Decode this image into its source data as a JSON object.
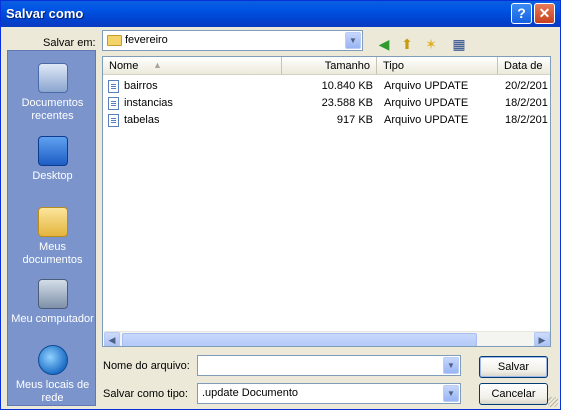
{
  "window": {
    "title": "Salvar como"
  },
  "toolbar": {
    "save_in_label": "Salvar em:",
    "current_folder": "fevereiro"
  },
  "places": [
    {
      "label": "Documentos recentes"
    },
    {
      "label": "Desktop"
    },
    {
      "label": "Meus documentos"
    },
    {
      "label": "Meu computador"
    },
    {
      "label": "Meus locais de rede"
    }
  ],
  "columns": {
    "name": "Nome",
    "size": "Tamanho",
    "type": "Tipo",
    "date": "Data de"
  },
  "files": [
    {
      "name": "bairros",
      "size": "10.840 KB",
      "type": "Arquivo UPDATE",
      "date": "20/2/201"
    },
    {
      "name": "instancias",
      "size": "23.588 KB",
      "type": "Arquivo UPDATE",
      "date": "18/2/201"
    },
    {
      "name": "tabelas",
      "size": "917 KB",
      "type": "Arquivo UPDATE",
      "date": "18/2/201"
    }
  ],
  "form": {
    "filename_label": "Nome do arquivo:",
    "filename_value": "",
    "filetype_label": "Salvar como tipo:",
    "filetype_value": ".update Documento"
  },
  "buttons": {
    "save": "Salvar",
    "cancel": "Cancelar"
  },
  "icons": {
    "help": "?",
    "close": "✕",
    "back": "◀",
    "up": "⬆",
    "new_folder": "✶",
    "views": "▦"
  },
  "colors": {
    "titlebar": "#0055e5",
    "places_bar": "#7b94cc"
  }
}
